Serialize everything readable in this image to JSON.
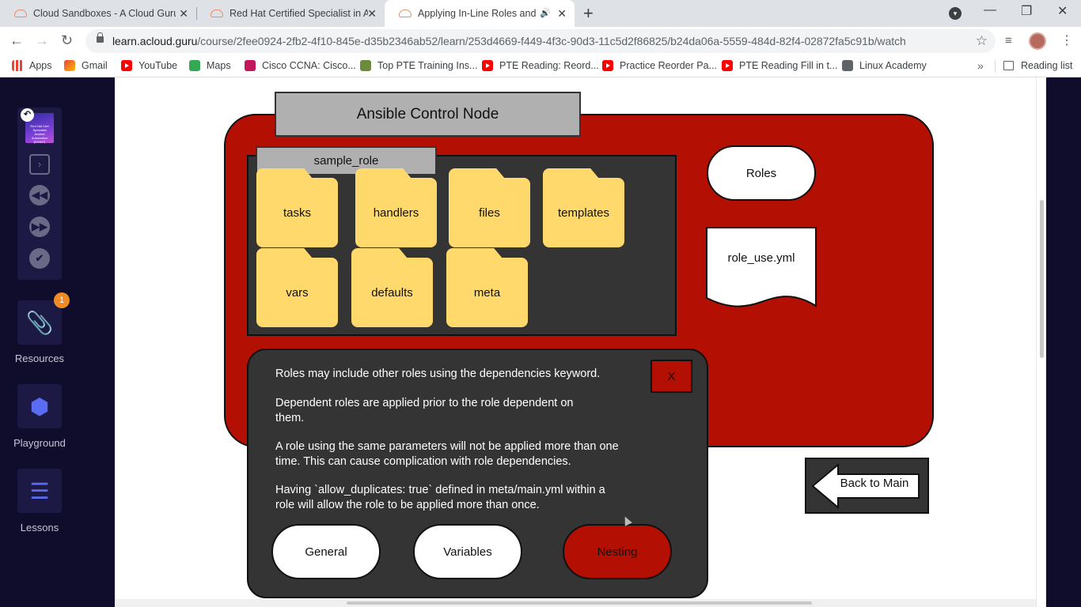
{
  "browser": {
    "tabs": [
      {
        "title": "Cloud Sandboxes - A Cloud Guru",
        "active": false
      },
      {
        "title": "Red Hat Certified Specialist in An",
        "active": false
      },
      {
        "title": "Applying In-Line Roles and R",
        "active": true
      }
    ],
    "url": {
      "host": "learn.acloud.guru",
      "path": "/course/2fee0924-2fb2-4f10-845e-d35b2346ab52/learn/253d4669-f449-4f3c-90d3-11c5d2f86825/b24da06a-5559-484d-82f4-02872fa5c91b/watch"
    },
    "bookmarks": [
      {
        "label": "Apps",
        "icon": "apps-icon"
      },
      {
        "label": "Gmail",
        "icon": "gmail-icon"
      },
      {
        "label": "YouTube",
        "icon": "youtube-icon"
      },
      {
        "label": "Maps",
        "icon": "maps-icon"
      },
      {
        "label": "Cisco CCNA: Cisco...",
        "icon": "cisco-icon"
      },
      {
        "label": "Top PTE Training Ins...",
        "icon": "pte-icon"
      },
      {
        "label": "PTE Reading: Reord...",
        "icon": "youtube-icon"
      },
      {
        "label": "Practice Reorder Pa...",
        "icon": "youtube-icon"
      },
      {
        "label": "PTE Reading Fill in t...",
        "icon": "youtube-icon"
      },
      {
        "label": "Linux Academy",
        "icon": "linux-academy-icon"
      }
    ],
    "reading_list": "Reading list"
  },
  "sidebar": {
    "resources_badge": "1",
    "items": [
      {
        "label": "Resources",
        "icon": "paperclip-icon"
      },
      {
        "label": "Playground",
        "icon": "cube-icon"
      },
      {
        "label": "Lessons",
        "icon": "list-icon"
      }
    ],
    "thumbnail_caption": "Red Hat Cert Specialist Ansible Automation (EX407)"
  },
  "slide": {
    "control_node": "Ansible Control Node",
    "role_name": "sample_role",
    "folders": [
      "tasks",
      "handlers",
      "files",
      "templates",
      "vars",
      "defaults",
      "meta"
    ],
    "roles_label": "Roles",
    "doc_label": "role_use.yml",
    "info": {
      "p1": "Roles may include other roles using the dependencies keyword.",
      "p2": "Dependent roles are applied prior to the role dependent on them.",
      "p3": "A role using the same parameters will not be applied more than one time.  This can cause complication with role dependencies.",
      "p4": "Having `allow_duplicates: true` defined in meta/main.yml within a role will allow the role to be applied more than once.",
      "close": "X"
    },
    "buttons": {
      "general": "General",
      "variables": "Variables",
      "nesting": "Nesting"
    },
    "back": "Back to Main"
  },
  "colors": {
    "red": "#b30f02",
    "folder": "#ffd96b",
    "panel": "#343434",
    "sidebar": "#0f0d2b"
  }
}
